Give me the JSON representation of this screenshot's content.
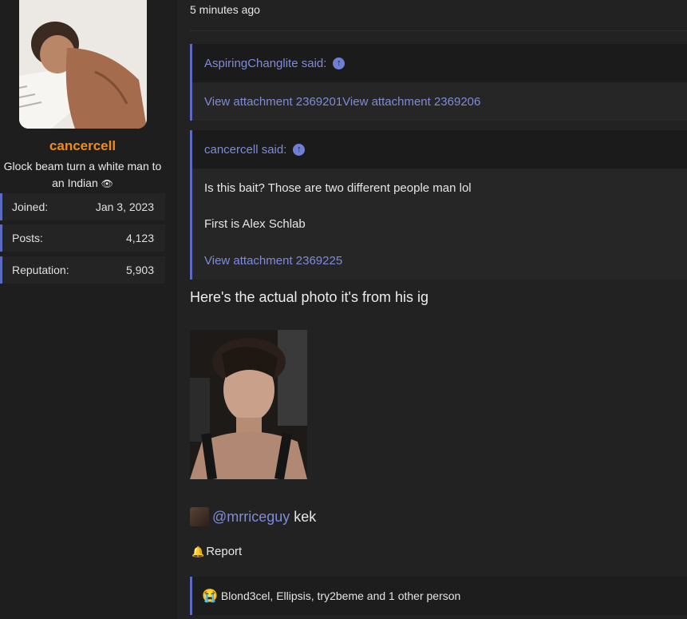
{
  "user": {
    "username": "cancercell",
    "title": "Glock beam turn a white man to an Indian",
    "title_emoji": "👁",
    "stats": [
      {
        "key": "Joined:",
        "value": "Jan 3, 2023"
      },
      {
        "key": "Posts:",
        "value": "4,123"
      },
      {
        "key": "Reputation:",
        "value": "5,903"
      }
    ]
  },
  "post": {
    "timestamp": "5 minutes ago",
    "quotes": [
      {
        "author_line": "AspiringChanglite said:",
        "lines": [
          "View attachment 2369201View attachment 2369206"
        ]
      },
      {
        "author_line": "cancercell said:",
        "lines": [
          "Is this bait? Those are two different people man lol",
          "First is Alex Schlab",
          "View attachment 2369225"
        ]
      }
    ],
    "body_text": "Here's the actual photo it's from his ig",
    "mention": {
      "handle": "@mrriceguy",
      "text": "kek"
    },
    "report_label": "Report",
    "reactions_text": "Blond3cel, Ellipsis, try2beme and 1 other person",
    "reaction_emoji": "😭"
  },
  "colors": {
    "accent": "#5c6bc0",
    "link": "#7f8bd9",
    "username": "#f28b16"
  }
}
